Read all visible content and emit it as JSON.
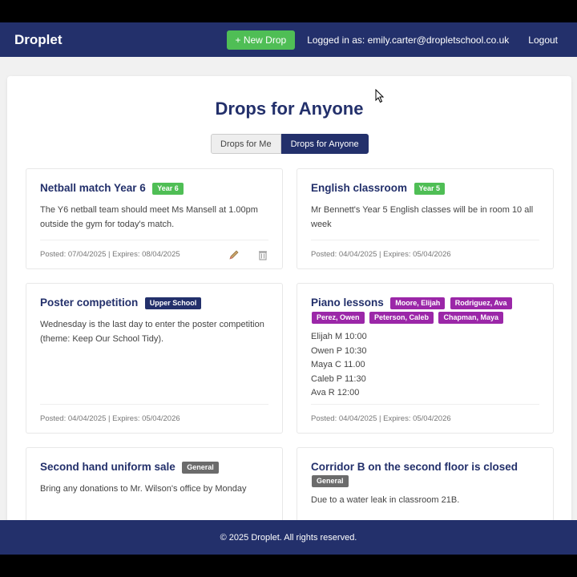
{
  "nav": {
    "brand": "Droplet",
    "new_drop": "+ New Drop",
    "logged_in": "Logged in as: emily.carter@dropletschool.co.uk",
    "logout": "Logout"
  },
  "page": {
    "title": "Drops for Anyone",
    "tabs": [
      "Drops for Me",
      "Drops for Anyone"
    ],
    "active_tab": "Drops for Anyone"
  },
  "cards": [
    {
      "title": "Netball match Year 6",
      "badges": [
        {
          "label": "Year 6",
          "color": "#4fbe55"
        }
      ],
      "body": "The Y6 netball team should meet Ms Mansell at 1.00pm outside the gym for today's match.",
      "meta": "Posted: 07/04/2025 | Expires: 08/04/2025",
      "icons": [
        "pencil-icon",
        "trash-icon"
      ]
    },
    {
      "title": "English classroom",
      "badges": [
        {
          "label": "Year 5",
          "color": "#4fbe55"
        }
      ],
      "body": "Mr Bennett's Year 5 English classes will be in room 10 all week",
      "meta": "Posted: 04/04/2025 | Expires: 05/04/2026"
    },
    {
      "title": "Poster competition",
      "badges": [
        {
          "label": "Upper School",
          "color": "#23306b"
        }
      ],
      "body": "Wednesday is the last day to enter the poster competition (theme: Keep Our School Tidy).",
      "meta": "Posted: 04/04/2025 | Expires: 05/04/2026"
    },
    {
      "title": "Piano lessons",
      "badges": [
        {
          "label": "Moore, Elijah",
          "color": "#9b27a8"
        },
        {
          "label": "Rodriguez, Ava",
          "color": "#9b27a8"
        },
        {
          "label": "Perez, Owen",
          "color": "#9b27a8"
        },
        {
          "label": "Peterson, Caleb",
          "color": "#9b27a8"
        },
        {
          "label": "Chapman, Maya",
          "color": "#9b27a8"
        }
      ],
      "body_lines": [
        "Elijah M 10:00",
        "Owen P 10:30",
        "Maya C 11.00",
        "Caleb P 11:30",
        "Ava R 12:00"
      ],
      "meta": "Posted: 04/04/2025 | Expires: 05/04/2026"
    },
    {
      "title": "Second hand uniform sale",
      "badges": [
        {
          "label": "General",
          "color": "#6b6b6b"
        }
      ],
      "body": "Bring any donations to Mr. Wilson's office by Monday"
    },
    {
      "title": "Corridor B on the second floor is closed",
      "badges": [
        {
          "label": "General",
          "color": "#6b6b6b"
        }
      ],
      "body": "Due to a water leak in classroom 21B."
    }
  ],
  "footer": "© 2025 Droplet. All rights reserved."
}
